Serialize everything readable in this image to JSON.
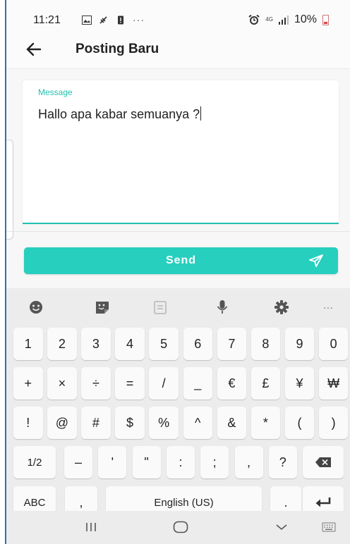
{
  "status_bar": {
    "time": "11:21",
    "more": "···",
    "network": "4G",
    "battery": "10%"
  },
  "app_bar": {
    "title": "Posting Baru",
    "back_icon": "arrow-left-icon"
  },
  "form": {
    "label": "Message",
    "value": "Hallo apa kabar semuanya ?"
  },
  "send_button": {
    "label": "Send",
    "icon": "paper-plane-icon"
  },
  "keyboard": {
    "toolbar": [
      "emoji-icon",
      "sticker-icon",
      "clipboard-icon",
      "microphone-icon",
      "settings-icon",
      "more-icon"
    ],
    "more_label": "···",
    "row1": [
      "1",
      "2",
      "3",
      "4",
      "5",
      "6",
      "7",
      "8",
      "9",
      "0"
    ],
    "row2": [
      "+",
      "×",
      "÷",
      "=",
      "/",
      "_",
      "€",
      "£",
      "¥",
      "₩"
    ],
    "row3": [
      "!",
      "@",
      "#",
      "$",
      "%",
      "^",
      "&",
      "*",
      "(",
      ")"
    ],
    "row4": [
      "1/2",
      "–",
      "'",
      "\"",
      ":",
      ";",
      ",",
      "?"
    ],
    "row5": {
      "abc": "ABC",
      "comma": ",",
      "space": "English (US)",
      "period": "."
    }
  },
  "colors": {
    "accent": "#27cfbe",
    "label": "#22c1b1"
  }
}
